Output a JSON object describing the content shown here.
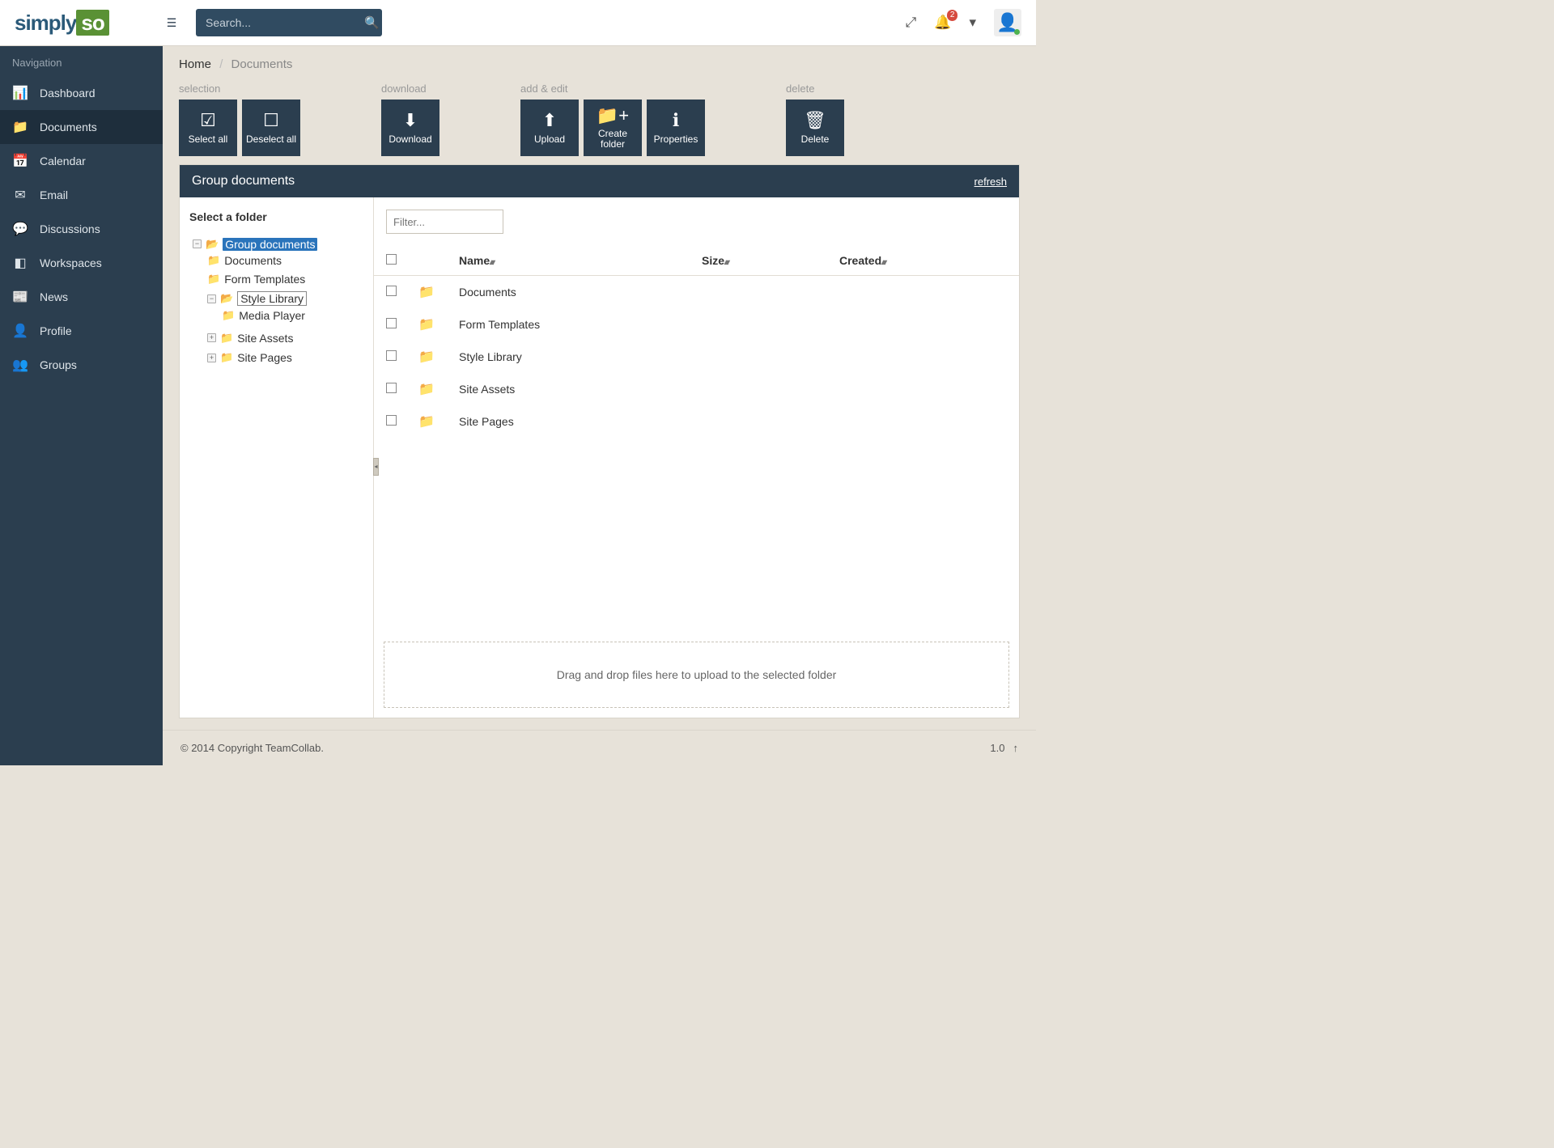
{
  "header": {
    "logo_a": "simply",
    "logo_b": "so",
    "search_placeholder": "Search...",
    "notification_count": "2"
  },
  "sidebar": {
    "title": "Navigation",
    "items": [
      {
        "label": "Dashboard",
        "icon": "📊"
      },
      {
        "label": "Documents",
        "icon": "📁",
        "active": true
      },
      {
        "label": "Calendar",
        "icon": "📅"
      },
      {
        "label": "Email",
        "icon": "✉"
      },
      {
        "label": "Discussions",
        "icon": "💬"
      },
      {
        "label": "Workspaces",
        "icon": "◧"
      },
      {
        "label": "News",
        "icon": "📰"
      },
      {
        "label": "Profile",
        "icon": "👤"
      },
      {
        "label": "Groups",
        "icon": "👥"
      }
    ]
  },
  "breadcrumb": {
    "home": "Home",
    "current": "Documents"
  },
  "toolbar": {
    "groups": {
      "selection": {
        "title": "selection",
        "btns": [
          {
            "label": "Select all",
            "icon": "☑"
          },
          {
            "label": "Deselect all",
            "icon": "☐"
          }
        ]
      },
      "download": {
        "title": "download",
        "btns": [
          {
            "label": "Download",
            "icon": "⬇"
          }
        ]
      },
      "add_edit": {
        "title": "add & edit",
        "btns": [
          {
            "label": "Upload",
            "icon": "⬆"
          },
          {
            "label": "Create folder",
            "icon": "📁+"
          },
          {
            "label": "Properties",
            "icon": "ℹ"
          }
        ]
      },
      "delete": {
        "title": "delete",
        "btns": [
          {
            "label": "Delete",
            "icon": "🗑"
          }
        ]
      }
    }
  },
  "panel": {
    "title": "Group documents",
    "refresh": "refresh",
    "tree_title": "Select a folder",
    "tree": {
      "root": "Group documents",
      "c1": "Documents",
      "c2": "Form Templates",
      "c3": "Style Library",
      "c3a": "Media Player",
      "c4": "Site Assets",
      "c5": "Site Pages"
    },
    "filter_placeholder": "Filter...",
    "columns": {
      "name": "Name",
      "size": "Size",
      "created": "Created"
    },
    "rows": [
      {
        "name": "Documents"
      },
      {
        "name": "Form Templates"
      },
      {
        "name": "Style Library"
      },
      {
        "name": "Site Assets"
      },
      {
        "name": "Site Pages"
      }
    ],
    "dropzone": "Drag and drop files here to upload to the selected folder"
  },
  "footer": {
    "copyright": "© 2014 Copyright TeamCollab.",
    "version": "1.0"
  }
}
